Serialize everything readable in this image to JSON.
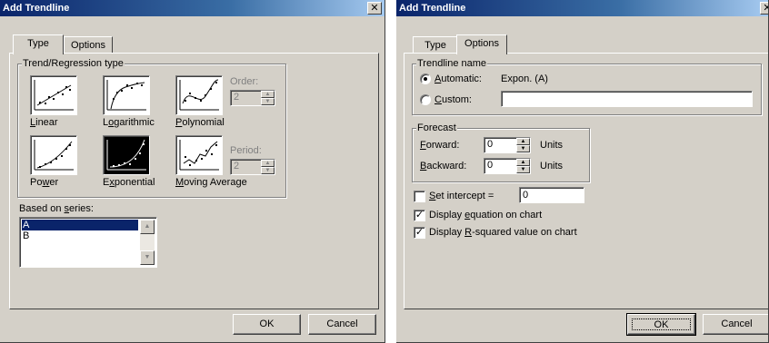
{
  "left_dialog": {
    "title": "Add Trendline",
    "close_glyph": "✕",
    "tabs": [
      "Type",
      "Options"
    ],
    "active_tab": "Type",
    "group_title": "Trend/Regression type",
    "trend_types": [
      {
        "label": "Linear",
        "mnemonic": "L",
        "rest": "inear",
        "icon": "linear-trend-icon"
      },
      {
        "label": "Logarithmic",
        "mnemonic": "o",
        "pre": "L",
        "rest": "garithmic",
        "icon": "logarithmic-trend-icon"
      },
      {
        "label": "Polynomial",
        "mnemonic": "P",
        "rest": "olynomial",
        "icon": "polynomial-trend-icon"
      },
      {
        "label": "Power",
        "mnemonic": "w",
        "pre": "Po",
        "rest": "er",
        "icon": "power-trend-icon"
      },
      {
        "label": "Exponential",
        "mnemonic": "x",
        "pre": "E",
        "rest": "ponential",
        "icon": "exponential-trend-icon",
        "selected": true
      },
      {
        "label": "Moving Average",
        "mnemonic": "M",
        "rest": "oving Average",
        "icon": "moving-average-trend-icon"
      }
    ],
    "order": {
      "label": "Order:",
      "value": "2",
      "enabled": false
    },
    "period": {
      "label": "Period:",
      "value": "2",
      "enabled": false
    },
    "series_label_pre": "Based on ",
    "series_label_mn": "s",
    "series_label_rest": "eries:",
    "series": [
      "A",
      "B"
    ],
    "selected_series": "A",
    "buttons": {
      "ok": "OK",
      "cancel": "Cancel"
    }
  },
  "right_dialog": {
    "title": "Add Trendline",
    "tabs": [
      "Type",
      "Options"
    ],
    "active_tab": "Options",
    "trendline_name": {
      "group_title": "Trendline name",
      "automatic_pre": "",
      "automatic_mn": "A",
      "automatic_rest": "utomatic:",
      "automatic_value": "Expon. (A)",
      "custom_mn": "C",
      "custom_rest": "ustom:",
      "custom_value": "",
      "selected": "automatic"
    },
    "forecast": {
      "group_title": "Forecast",
      "forward_mn": "F",
      "forward_rest": "orward:",
      "forward_value": "0",
      "backward_mn": "B",
      "backward_rest": "ackward:",
      "backward_value": "0",
      "units": "Units"
    },
    "set_intercept": {
      "mn": "S",
      "rest": "et intercept =",
      "checked": false,
      "value": "0"
    },
    "display_equation": {
      "pre": "Display ",
      "mn": "e",
      "rest": "quation on chart",
      "checked": true
    },
    "display_rsquared": {
      "pre": "Display ",
      "mn": "R",
      "rest": "-squared value on chart",
      "checked": true
    },
    "buttons": {
      "ok": "OK",
      "cancel": "Cancel"
    }
  }
}
